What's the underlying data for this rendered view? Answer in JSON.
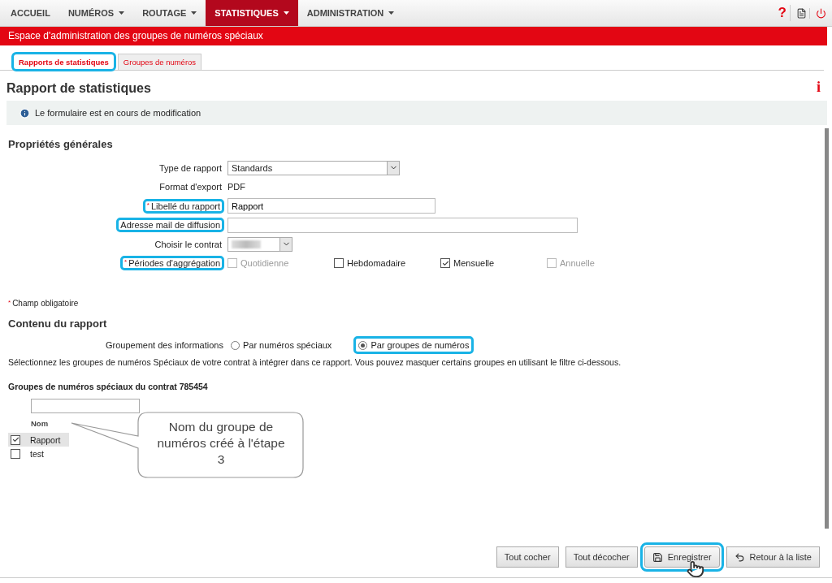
{
  "nav": {
    "items": [
      {
        "label": "ACCUEIL",
        "has_menu": false,
        "selected": false
      },
      {
        "label": "NUMÉROS",
        "has_menu": true,
        "selected": false
      },
      {
        "label": "ROUTAGE",
        "has_menu": true,
        "selected": false
      },
      {
        "label": "STATISTIQUES",
        "has_menu": true,
        "selected": true
      },
      {
        "label": "ADMINISTRATION",
        "has_menu": true,
        "selected": false
      }
    ],
    "help": "?"
  },
  "banner": "Espace d'administration des groupes de numéros spéciaux",
  "tabs": [
    {
      "label": "Rapports de statistiques",
      "selected": true,
      "highlighted": true
    },
    {
      "label": "Groupes de numéros",
      "selected": false,
      "highlighted": false
    }
  ],
  "page_title": "Rapport de statistiques",
  "info_symbol": "i",
  "notice": "Le formulaire est en cours de modification",
  "general": {
    "title": "Propriétés générales",
    "fields": [
      {
        "kind": "select",
        "label": "Type de rapport",
        "value": "Standards",
        "required": false,
        "highlighted": false
      },
      {
        "kind": "static",
        "label": "Format d'export",
        "value": "PDF",
        "required": false,
        "highlighted": false
      },
      {
        "kind": "text",
        "label": "Libellé du rapport",
        "value": "Rapport",
        "required": true,
        "highlighted": true
      },
      {
        "kind": "wide_text",
        "label": "Adresse mail de diffusion",
        "required": false,
        "highlighted": true
      },
      {
        "kind": "blurred_select",
        "label": "Choisir le contrat",
        "required": false,
        "highlighted": false
      },
      {
        "kind": "checks",
        "label": "Périodes d'aggrégation",
        "required": true,
        "highlighted": true,
        "options": [
          {
            "label": "Quotidienne",
            "checked": false,
            "disabled": true
          },
          {
            "label": "Hebdomadaire",
            "checked": false,
            "disabled": false
          },
          {
            "label": "Mensuelle",
            "checked": true,
            "disabled": false
          },
          {
            "label": "Annuelle",
            "checked": false,
            "disabled": true
          }
        ]
      }
    ]
  },
  "required_note": {
    "mark": "*",
    "text": "Champ obligatoire"
  },
  "content": {
    "title": "Contenu du rapport",
    "grouping_label": "Groupement des informations",
    "grouping_options": [
      {
        "label": "Par numéros spéciaux",
        "selected": false,
        "highlighted": false
      },
      {
        "label": "Par groupes de numéros",
        "selected": true,
        "highlighted": true
      }
    ],
    "instructions": "Sélectionnez les groupes de numéros Spéciaux de votre contrat à intégrer dans ce rapport. Vous pouvez masquer certains groupes en utilisant le filtre ci-dessous.",
    "groups_title": "Groupes de numéros spéciaux du contrat 785454",
    "column": "Nom",
    "groups": [
      {
        "name": "Rapport",
        "checked": true,
        "selected": true
      },
      {
        "name": "test",
        "checked": false,
        "selected": false
      }
    ]
  },
  "callout": "Nom du groupe de numéros créé à l'étape 3",
  "buttons": [
    {
      "kind": "plain",
      "label": "Tout cocher",
      "highlighted": false
    },
    {
      "kind": "plain",
      "label": "Tout décocher",
      "highlighted": false
    },
    {
      "kind": "save",
      "label": "Enregistrer",
      "highlighted": true
    },
    {
      "kind": "back",
      "label": "Retour à la liste",
      "highlighted": false
    }
  ]
}
